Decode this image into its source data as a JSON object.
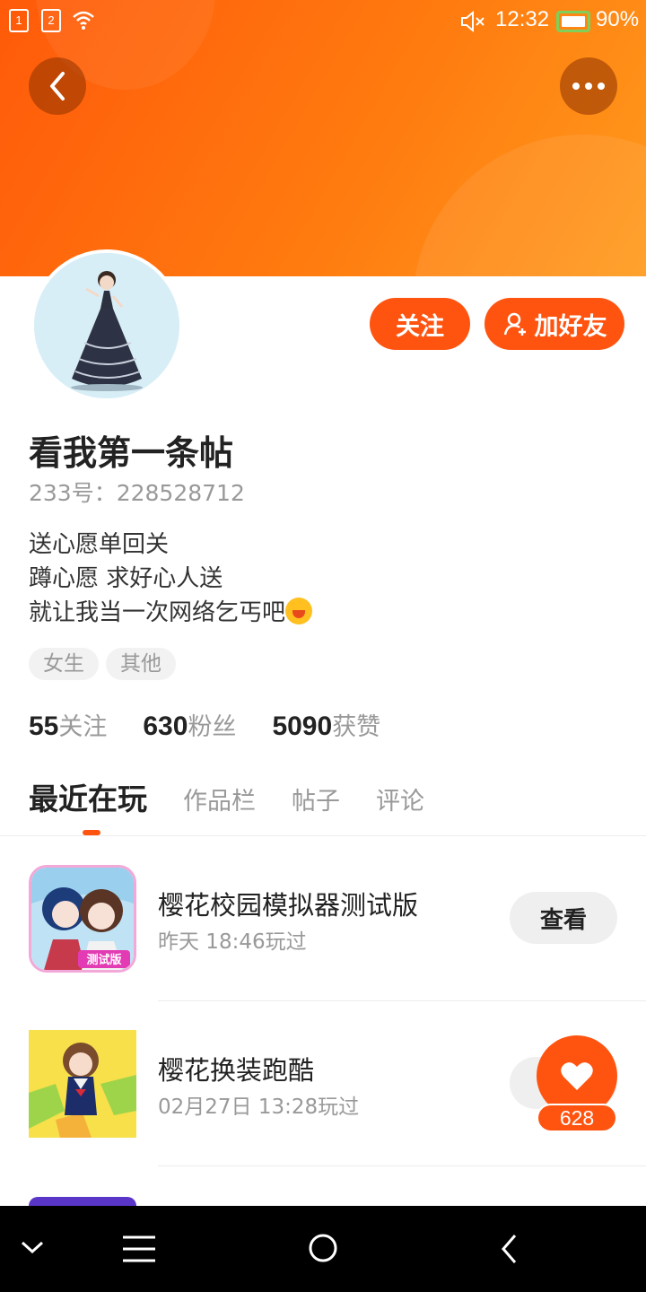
{
  "status_bar": {
    "sim1": "1",
    "sim2": "2",
    "time": "12:32",
    "battery": "90%"
  },
  "header": {
    "back_icon": "chevron-left-icon",
    "more_icon": "more-horizontal-icon"
  },
  "profile": {
    "follow_label": "关注",
    "add_friend_label": "加好友",
    "name": "看我第一条帖",
    "uid": "233号：228528712",
    "bio": [
      "送心愿单回关",
      "蹲心愿 求好心人送",
      "就让我当一次网络乞丐吧"
    ],
    "tags": [
      "女生",
      "其他"
    ],
    "stats": [
      {
        "value": "55",
        "label": "关注"
      },
      {
        "value": "630",
        "label": "粉丝"
      },
      {
        "value": "5090",
        "label": "获赞"
      }
    ]
  },
  "tabs": [
    "最近在玩",
    "作品栏",
    "帖子",
    "评论"
  ],
  "games": [
    {
      "title": "樱花校园模拟器测试版",
      "time": "昨天 18:46玩过",
      "action": "查看",
      "badge": "测试版"
    },
    {
      "title": "樱花换装跑酷",
      "time": "02月27日 13:28玩过",
      "action": "查看"
    }
  ],
  "like_float": {
    "count": "628"
  },
  "colors": {
    "accent": "#ff5410",
    "banner": "#ff7a0f"
  }
}
